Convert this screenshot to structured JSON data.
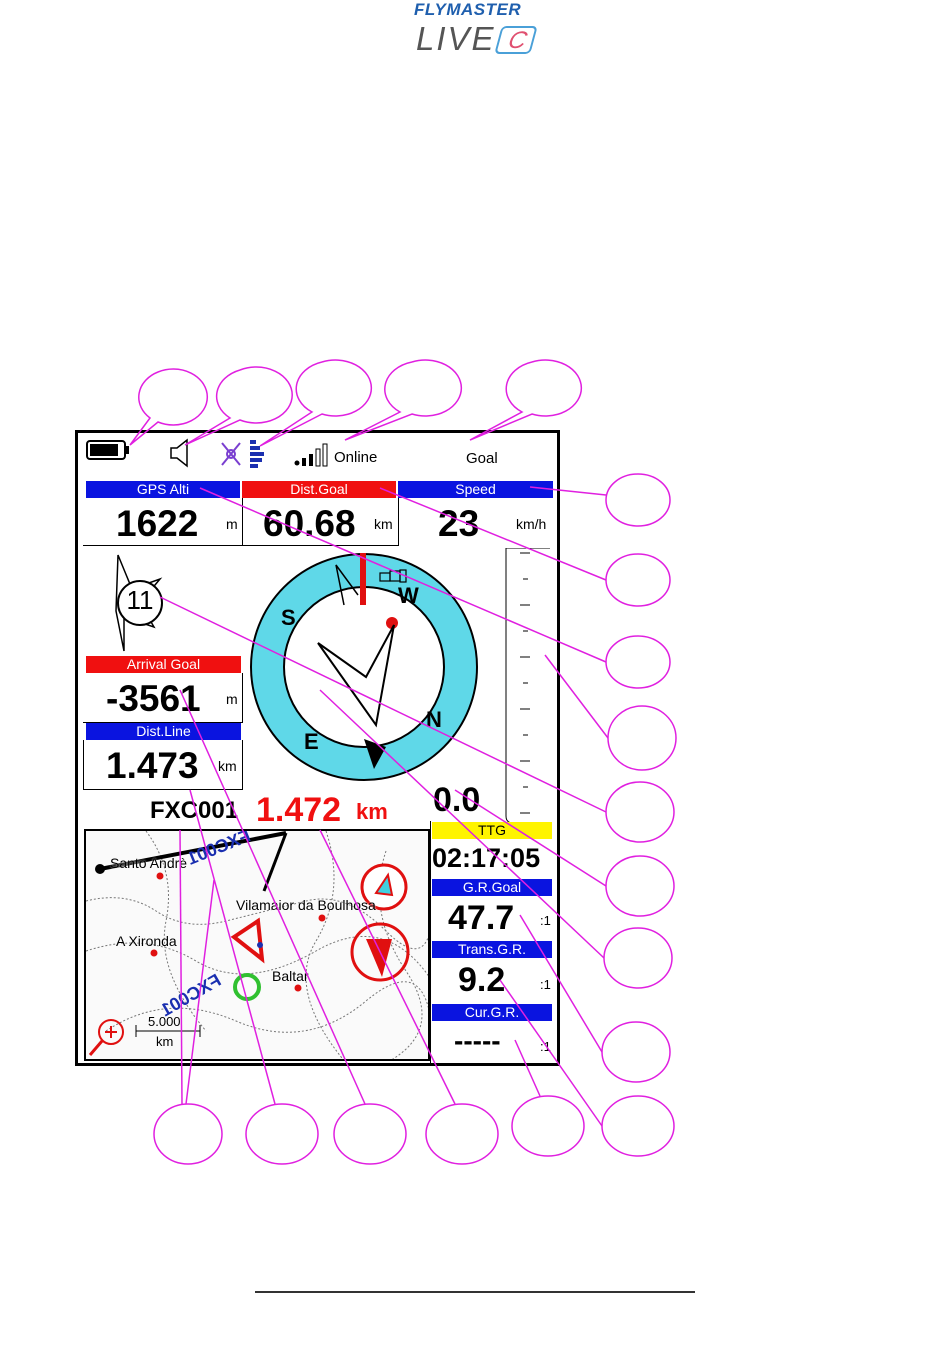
{
  "brand": {
    "name": "FLYMASTER",
    "model": "LIVE",
    "model_suffix": "C"
  },
  "status_bar": {
    "network_label": "Online",
    "page_label": "Goal"
  },
  "fields": {
    "gps_alti": {
      "label": "GPS Alti",
      "value": "1622",
      "unit": "m"
    },
    "dist_goal": {
      "label": "Dist.Goal",
      "value": "60.68",
      "unit": "km"
    },
    "speed": {
      "label": "Speed",
      "value": "23",
      "unit": "km/h"
    },
    "arrival_goal": {
      "label": "Arrival Goal",
      "value": "-3561",
      "unit": "m"
    },
    "dist_line": {
      "label": "Dist.Line",
      "value": "1.473",
      "unit": "km"
    },
    "ttg": {
      "label": "TTG",
      "value": "02:17:05"
    },
    "gr_goal": {
      "label": "G.R.Goal",
      "value": "47.7",
      "unit": ":1"
    },
    "trans_gr": {
      "label": "Trans.G.R.",
      "value": "9.2",
      "unit": ":1"
    },
    "cur_gr": {
      "label": "Cur.G.R.",
      "value": "-----",
      "unit": ":1"
    }
  },
  "wind": {
    "speed": "11"
  },
  "compass": {
    "labels": [
      "W",
      "S",
      "N",
      "E"
    ]
  },
  "vario": {
    "value": "0.0"
  },
  "waypoint": {
    "name": "FXC001",
    "distance": "1.472",
    "unit": "km"
  },
  "map": {
    "places": [
      "Santo Andrè",
      "Vilamaior da Boulhosa",
      "A Xironda",
      "Baltar"
    ],
    "route_label": "FXC001",
    "scale_value": "5.000",
    "scale_unit": "km"
  },
  "colors": {
    "accent_blue": "#0a14e0",
    "accent_red": "#f01010",
    "callout": "#e020e0",
    "compass_ring": "#5fd8e8"
  }
}
